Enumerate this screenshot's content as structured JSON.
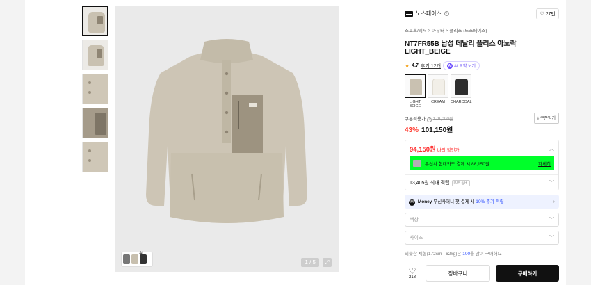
{
  "gallery": {
    "thumbnails": [
      "front",
      "side",
      "collar-detail",
      "pocket-detail",
      "hem-detail"
    ],
    "pager": "1 / 5",
    "ai_tag": "AI"
  },
  "brand": {
    "name": "노스페이스",
    "likes": "27만"
  },
  "breadcrumb": "스포츠/레저 > 아우터 > 플리스 (노스페이스)",
  "product": {
    "title": "NT7FR55B 남성 데날리 플리스 아노락 LIGHT_BEIGE",
    "rating": "4.7",
    "review": "후기 12개",
    "ai_summary": "AI 요약 보기"
  },
  "colors": [
    {
      "label": "LIGHT BEIGE",
      "hex": "#c9c1b1",
      "selected": true
    },
    {
      "label": "CREAM",
      "hex": "#f2efe8",
      "selected": false
    },
    {
      "label": "CHARCOAL",
      "hex": "#2d2d2d",
      "selected": false
    }
  ],
  "price": {
    "coupon_label": "쿠폰적용가",
    "original": "179,000원",
    "coupon_button": "쿠폰받기",
    "discount": "43%",
    "final": "101,150원",
    "my_price": "94,150원",
    "my_price_label": "나의 할인가",
    "card_promo": "무신사 현대카드 결제 시 88,150원",
    "card_link": "자세히",
    "points": "13,405원 최대 적립",
    "level": "LV.5 실버",
    "money_promo_prefix": "Money",
    "money_promo_text": "무신사머니 첫 결제 시",
    "money_promo_highlight": "10% 추가 적립"
  },
  "options": {
    "color_placeholder": "색상",
    "size_placeholder": "사이즈"
  },
  "size_hint_prefix": "비슷한 체형(172cm · 62kg)은",
  "size_hint_num": "100",
  "size_hint_suffix": "을 많이 구매해요",
  "actions": {
    "wishlist_count": "218",
    "cart": "장바구니",
    "buy": "구매하기"
  }
}
